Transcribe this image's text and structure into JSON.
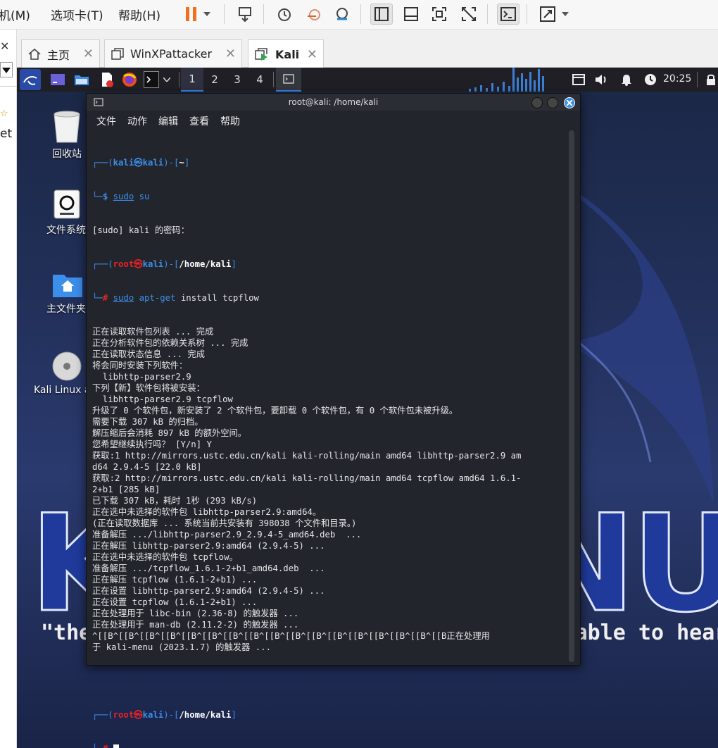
{
  "vmware": {
    "menus": [
      "机(M)",
      "选项卡(T)",
      "帮助(H)"
    ]
  },
  "left_strip": {
    "text": "et"
  },
  "tabs": [
    {
      "label": "主页",
      "icon": "home-icon"
    },
    {
      "label": "WinXPattacker",
      "icon": "vm-icon"
    },
    {
      "label": "Kali",
      "icon": "vm-running-icon",
      "active": true
    }
  ],
  "kali_panel": {
    "workspaces": [
      "1",
      "2",
      "3",
      "4"
    ],
    "active_workspace": "1",
    "time": "20:25"
  },
  "desktop": {
    "icons": [
      {
        "label": "回收站",
        "icon": "trash-icon"
      },
      {
        "label": "文件系统",
        "icon": "filesystem-icon"
      },
      {
        "label": "主文件夹",
        "icon": "home-folder-icon"
      },
      {
        "label": "Kali Linux a",
        "icon": "disc-icon"
      }
    ],
    "logo_text": "KALI LINUX",
    "quote": "\"the quieter you become, the more you are able to hear\""
  },
  "terminal": {
    "title": "root@kali: /home/kali",
    "menu": [
      "文件",
      "动作",
      "编辑",
      "查看",
      "帮助"
    ],
    "prompt1": {
      "user": "kali",
      "host": "kali",
      "path": "~",
      "cmd1": "sudo",
      "cmd_rest": " su"
    },
    "password_line": "[sudo] kali 的密码：",
    "prompt2": {
      "user": "root",
      "host": "kali",
      "path": "/home/kali",
      "cmd1": "sudo",
      "cmd2": "apt-get",
      "cmd_rest": " install tcpflow"
    },
    "output": [
      "正在读取软件包列表 ... 完成",
      "正在分析软件包的依赖关系树 ... 完成",
      "正在读取状态信息 ... 完成",
      "将会同时安装下列软件：",
      "  libhttp-parser2.9",
      "下列【新】软件包将被安装：",
      "  libhttp-parser2.9 tcpflow",
      "升级了 0 个软件包，新安装了 2 个软件包，要卸载 0 个软件包，有 0 个软件包未被升级。",
      "需要下载 307 kB 的归档。",
      "解压缩后会消耗 897 kB 的额外空间。",
      "您希望继续执行吗？ [Y/n] Y",
      "获取:1 http://mirrors.ustc.edu.cn/kali kali-rolling/main amd64 libhttp-parser2.9 am",
      "d64 2.9.4-5 [22.0 kB]",
      "获取:2 http://mirrors.ustc.edu.cn/kali kali-rolling/main amd64 tcpflow amd64 1.6.1-",
      "2+b1 [285 kB]",
      "已下载 307 kB，耗时 1秒 (293 kB/s)",
      "正在选中未选择的软件包 libhttp-parser2.9:amd64。",
      "(正在读取数据库 ... 系统当前共安装有 398038 个文件和目录。)",
      "准备解压 .../libhttp-parser2.9_2.9.4-5_amd64.deb  ...",
      "正在解压 libhttp-parser2.9:amd64 (2.9.4-5) ...",
      "正在选中未选择的软件包 tcpflow。",
      "准备解压 .../tcpflow_1.6.1-2+b1_amd64.deb  ...",
      "正在解压 tcpflow (1.6.1-2+b1) ...",
      "正在设置 libhttp-parser2.9:amd64 (2.9.4-5) ...",
      "正在设置 tcpflow (1.6.1-2+b1) ...",
      "正在处理用于 libc-bin (2.36-8) 的触发器 ...",
      "正在处理用于 man-db (2.11.2-2) 的触发器 ...",
      "^[[B^[[B^[[B^[[B^[[B^[[B^[[B^[[B^[[B^[[B^[[B^[[B^[[B^[[B^[[B^[[B^[[B正在处理用",
      "于 kali-menu (2023.1.7) 的触发器 ..."
    ],
    "prompt3": {
      "user": "root",
      "host": "kali",
      "path": "/home/kali"
    }
  },
  "colors": {
    "kali_blue": "#3b8eea",
    "root_red": "#ee2222",
    "terminal_bg": "#23252d"
  }
}
